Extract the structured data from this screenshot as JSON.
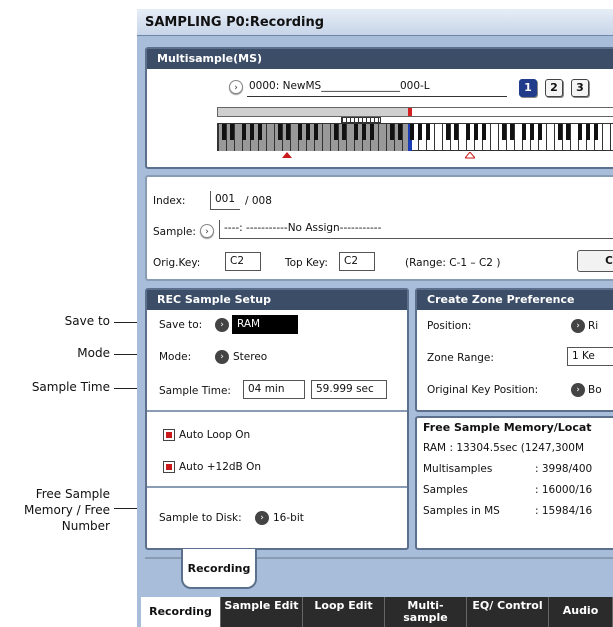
{
  "title": "SAMPLING P0:Recording",
  "multisample": {
    "header": "Multisample(MS)",
    "ms_name": "0000: NewMS_______________000-L",
    "buttons": [
      "1",
      "2",
      "3"
    ]
  },
  "sample_info": {
    "index_label": "Index:",
    "index_value": "001",
    "index_total": "/ 008",
    "sample_label": "Sample:",
    "sample_value": "----: -----------No Assign-----------",
    "orig_key_label": "Orig.Key:",
    "orig_key_value": "C2",
    "top_key_label": "Top Key:",
    "top_key_value": "C2",
    "range_text": "(Range:  C-1   – C2   )",
    "right_btn": "C"
  },
  "rec_setup": {
    "header": "REC Sample Setup",
    "save_to_label": "Save to:",
    "save_to_value": "RAM",
    "mode_label": "Mode:",
    "mode_value": "Stereo",
    "sample_time_label": "Sample Time:",
    "sample_time_min": "04 min",
    "sample_time_sec": "59.999 sec",
    "auto_loop": "Auto Loop On",
    "auto_12db": "Auto +12dB On",
    "sample_to_disk_label": "Sample to Disk:",
    "sample_to_disk_value": "16-bit"
  },
  "zone_pref": {
    "header": "Create Zone Preference",
    "position_label": "Position:",
    "position_value": "Ri",
    "zone_range_label": "Zone Range:",
    "zone_range_value": "1 Ke",
    "orig_key_pos_label": "Original Key Position:",
    "orig_key_pos_value": "Bo"
  },
  "free_mem": {
    "header": "Free Sample Memory/Locat",
    "ram_line": "RAM :  13304.5sec  (1247,300M",
    "rows": [
      {
        "label": "Multisamples",
        "value": ": 3998/400"
      },
      {
        "label": "Samples",
        "value": ": 16000/16"
      },
      {
        "label": "Samples in MS",
        "value": ": 15984/16"
      }
    ]
  },
  "page_tab": "Recording",
  "bottom_tabs": [
    "Recording",
    "Sample Edit",
    "Loop Edit",
    "Multi- sample",
    "EQ/ Control",
    "Audio"
  ],
  "callouts": {
    "save_to": "Save to",
    "mode": "Mode",
    "sample_time": "Sample Time",
    "free_sample": "Free Sample Memory / Free Number"
  }
}
